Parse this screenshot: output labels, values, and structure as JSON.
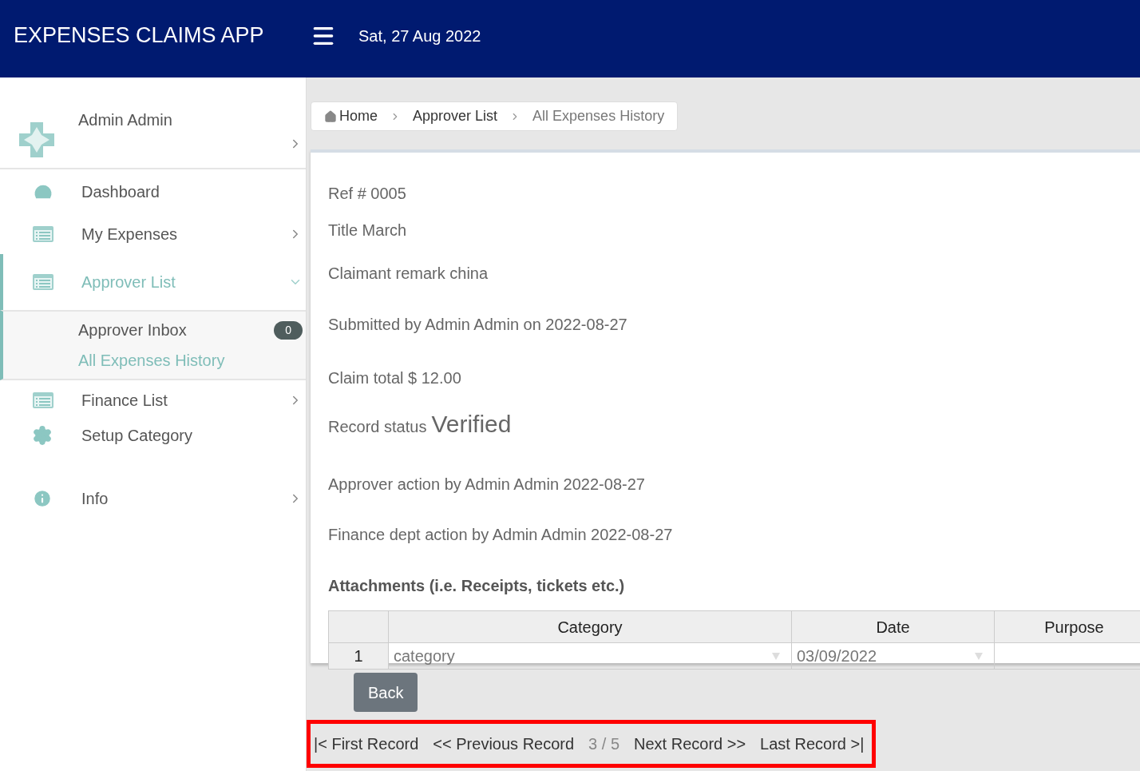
{
  "header": {
    "title": "EXPENSES CLAIMS APP",
    "date": "Sat, 27 Aug 2022"
  },
  "sidebar": {
    "user": "Admin Admin",
    "items": [
      {
        "kind": "link",
        "label": "Dashboard"
      },
      {
        "kind": "group",
        "label": "My Expenses",
        "expanded": false,
        "selected": false
      },
      {
        "kind": "group",
        "label": "Approver List",
        "expanded": true,
        "selected": true,
        "children": [
          {
            "label": "Approver Inbox",
            "badge": "0",
            "selected": false
          },
          {
            "label": "All Expenses History",
            "selected": true
          }
        ]
      },
      {
        "kind": "group",
        "label": "Finance List",
        "expanded": false,
        "selected": false
      },
      {
        "kind": "link",
        "label": "Setup Category"
      },
      {
        "kind": "group",
        "label": "Info",
        "expanded": false,
        "selected": false
      }
    ]
  },
  "breadcrumb": [
    "Home",
    "Approver List",
    "All Expenses History"
  ],
  "details": [
    {
      "kind": "line",
      "text": "Ref # 0005"
    },
    {
      "kind": "line",
      "text": "Title March"
    },
    {
      "kind": "line",
      "text": "Claimant remark china"
    },
    {
      "kind": "line",
      "text": "Submitted by Admin Admin on 2022-08-27"
    },
    {
      "kind": "line",
      "text": "Claim total $ 12.00"
    },
    {
      "kind": "status",
      "label": "Record status",
      "value": "Verified"
    },
    {
      "kind": "line",
      "text": "Approver action by Admin Admin 2022-08-27"
    },
    {
      "kind": "line",
      "text": "Finance dept action by Admin Admin 2022-08-27"
    }
  ],
  "attachments": {
    "title": "Attachments (i.e. Receipts, tickets etc.)",
    "columns": [
      "Category",
      "Date",
      "Purpose"
    ],
    "rows": [
      {
        "number": "1",
        "category": "category",
        "date": "03/09/2022"
      }
    ]
  },
  "back_button": "Back",
  "pager": {
    "first": "|< First Record",
    "previous": "<< Previous Record",
    "position": "3 / 5",
    "next": "Next Record >>",
    "last": "Last Record >|"
  }
}
